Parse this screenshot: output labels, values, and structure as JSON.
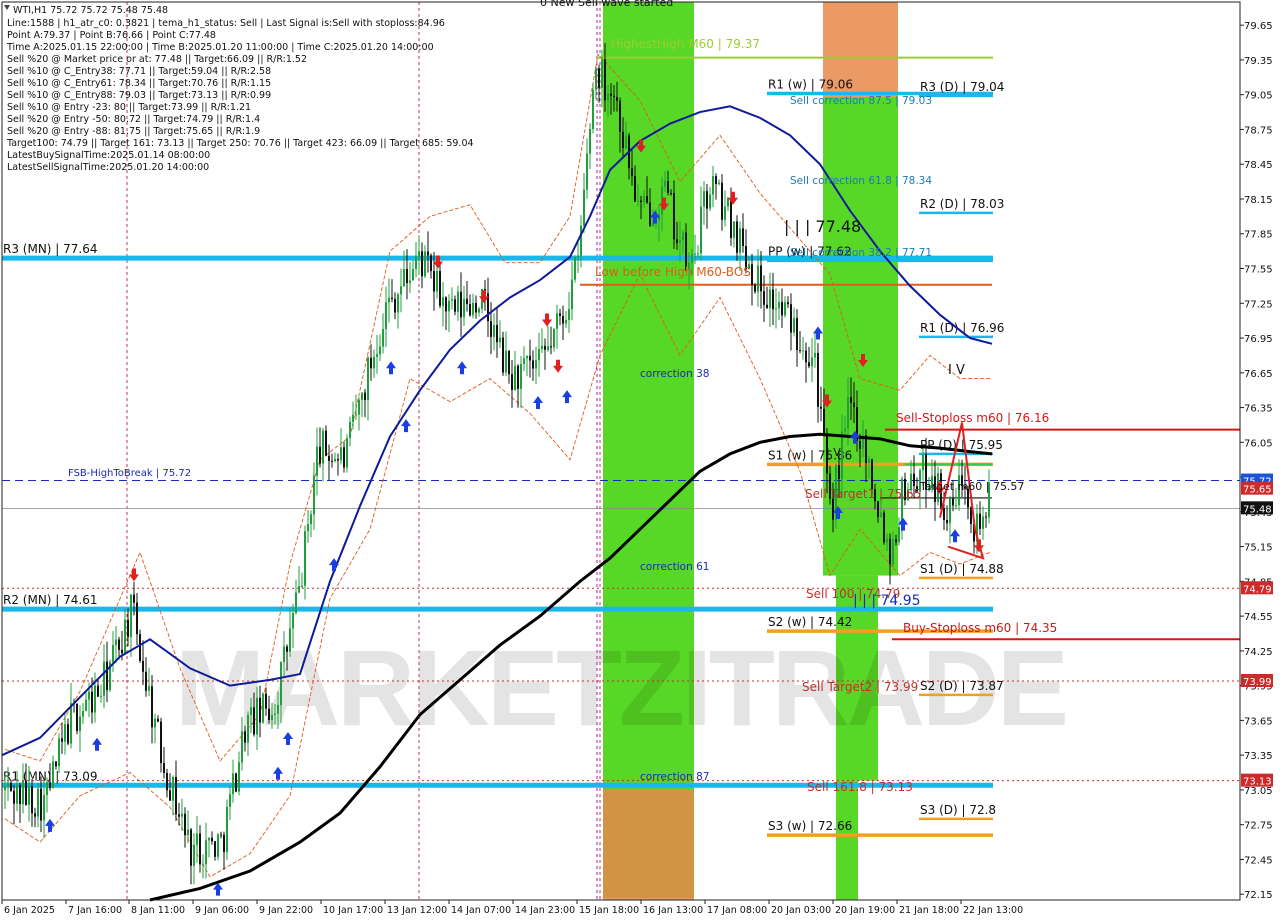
{
  "chart_data": {
    "type": "candlestick",
    "symbol": "WTI,H1",
    "header_line": "WTI,H1  75.72 75.72 75.48 75.48",
    "info_lines": [
      "Line:1588 | h1_atr_c0: 0.3821 | tema_h1_status: Sell | Last Signal is:Sell with stoploss:84.96",
      "Point A:79.37 | Point B:76.66 | Point C:77.48",
      "Time A:2025.01.15 22:00:00 | Time B:2025.01.20 11:00:00 | Time C:2025.01.20 14:00:00",
      "Sell %20 @ Market price or at: 77.48 || Target:66.09 || R/R:1.52",
      "Sell %10 @ C_Entry38: 77.71 || Target:59.04 || R/R:2.58",
      "Sell %10 @ C_Entry61: 78.34 || Target:70.76 || R/R:1.15",
      "Sell %10 @ C_Entry88: 79.03 || Target:73.13 || R/R:0.99",
      "Sell %10 @ Entry -23: 80 || Target:73.99 || R/R:1.21",
      "Sell %20 @ Entry -50: 80.72 || Target:74.79 || R/R:1.4",
      "Sell %20 @ Entry -88: 81.75 || Target:75.65 || R/R:1.9",
      "Target100: 74.79 || Target 161: 73.13 || Target 250: 70.76 || Target 423: 66.09 || Target 685: 59.04",
      "LatestBuySignalTime:2025.01.14 08:00:00",
      "LatestSellSignalTime:2025.01.20 14:00:00"
    ],
    "top_note": "0 New Sell wave started",
    "y_ticks": [
      "79.65",
      "79.35",
      "79.05",
      "78.75",
      "78.45",
      "78.15",
      "77.85",
      "77.55",
      "77.25",
      "76.95",
      "76.65",
      "76.35",
      "76.05",
      "75.75",
      "75.45",
      "75.15",
      "74.85",
      "74.55",
      "74.25",
      "73.95",
      "73.65",
      "73.35",
      "73.05",
      "72.75",
      "72.45",
      "72.15"
    ],
    "ylim": [
      72.1,
      79.85
    ],
    "x_ticks": [
      "6 Jan 2025",
      "7 Jan 16:00",
      "8 Jan 11:00",
      "9 Jan 06:00",
      "9 Jan 22:00",
      "10 Jan 17:00",
      "13 Jan 12:00",
      "14 Jan 07:00",
      "14 Jan 23:00",
      "15 Jan 18:00",
      "16 Jan 13:00",
      "17 Jan 08:00",
      "20 Jan 03:00",
      "20 Jan 19:00",
      "21 Jan 18:00",
      "22 Jan 13:00"
    ],
    "price_tags": [
      {
        "value": 75.72,
        "text": "75.72",
        "bg": "#1a52d8"
      },
      {
        "value": 75.65,
        "text": "75.65",
        "bg": "#cf2a2a"
      },
      {
        "value": 75.48,
        "text": "75.48",
        "bg": "#111111"
      },
      {
        "value": 74.79,
        "text": "74.79",
        "bg": "#cf2a2a"
      },
      {
        "value": 73.99,
        "text": "73.99",
        "bg": "#cf2a2a"
      },
      {
        "value": 73.13,
        "text": "73.13",
        "bg": "#cf2a2a"
      }
    ],
    "levels": [
      {
        "label": "R3 (MN) | 77.64",
        "value": 77.64,
        "color": "#1ab7ea",
        "style": "thick"
      },
      {
        "label": "R2 (MN) | 74.61",
        "value": 74.61,
        "color": "#1ab7ea",
        "style": "thick"
      },
      {
        "label": "R1 (MN) | 73.09",
        "value": 73.09,
        "color": "#1ab7ea",
        "style": "thick"
      },
      {
        "label": "R1 (w) | 79.06",
        "value": 79.06,
        "color": "#1ab7ea",
        "style": "medium"
      },
      {
        "label": "PP (w) | 77.62",
        "value": 77.62,
        "color": "#1ab7ea",
        "style": "medium"
      },
      {
        "label": "S1 (w) | 75.86",
        "value": 75.86,
        "color": "#f0a020",
        "style": "medium"
      },
      {
        "label": "S2 (w) | 74.42",
        "value": 74.42,
        "color": "#f0a020",
        "style": "medium"
      },
      {
        "label": "S3 (w) | 72.66",
        "value": 72.66,
        "color": "#f0a020",
        "style": "medium"
      },
      {
        "label": "R3 (D) | 79.04",
        "value": 79.04,
        "color": "#1ab7ea",
        "style": "short"
      },
      {
        "label": "R2 (D) | 78.03",
        "value": 78.03,
        "color": "#1ab7ea",
        "style": "short"
      },
      {
        "label": "R1 (D) | 76.96",
        "value": 76.96,
        "color": "#1ab7ea",
        "style": "short"
      },
      {
        "label": "PP (D) | 75.95",
        "value": 75.95,
        "color": "#1ab7ea",
        "style": "short"
      },
      {
        "label": "S1 (D) | 74.88",
        "value": 74.88,
        "color": "#f0a020",
        "style": "short"
      },
      {
        "label": "S2 (D) | 73.87",
        "value": 73.87,
        "color": "#f0a020",
        "style": "short"
      },
      {
        "label": "S3 (D) | 72.8",
        "value": 72.8,
        "color": "#f0a020",
        "style": "short"
      }
    ],
    "annotations": [
      {
        "text": "HighestHigh   M60 | 79.37",
        "value": 79.37,
        "color": "#9acd32"
      },
      {
        "text": "Low before High   M60-BOS",
        "value": 77.41,
        "color": "#e05a1a"
      },
      {
        "text": "Sell-Stoploss m60 | 76.16",
        "value": 76.16,
        "color": "#d01818"
      },
      {
        "text": "Buy-Stoploss m60 | 74.35",
        "value": 74.35,
        "color": "#d01818"
      },
      {
        "text": "FSB-HighToBreak | 75.72",
        "value": 75.72,
        "color": "#1a2bb8"
      },
      {
        "text": "Sell correction 87.5 | 79.03",
        "color": "#1a7ab8"
      },
      {
        "text": "Sell correction 61.8 | 78.34",
        "color": "#1a7ab8"
      },
      {
        "text": "Sell correction 38.2 | 77.71",
        "color": "#1a7ab8"
      },
      {
        "text": "correction 38",
        "color": "#1a2bb8"
      },
      {
        "text": "correction 61",
        "color": "#1a2bb8"
      },
      {
        "text": "correction 87",
        "color": "#1a2bb8"
      },
      {
        "text": "Sell Target1 | 75.65",
        "color": "#c03030"
      },
      {
        "text": "Sell 100 | 74.79",
        "color": "#c03030"
      },
      {
        "text": "Sell Target2 | 73.99",
        "color": "#c03030"
      },
      {
        "text": "Sell 161.8 | 73.13",
        "color": "#c03030"
      },
      {
        "text": "| | | 77.48",
        "color": "#111111"
      },
      {
        "text": "| | | 74.95",
        "color": "#1a2bb8"
      },
      {
        "text": "I V",
        "color": "#111111"
      },
      {
        "text": "| V",
        "color": "#111111"
      },
      {
        "text": "Target m60 | 75.57",
        "color": "#111111"
      }
    ],
    "watermark": "MARKETZITRADE",
    "colors": {
      "bull": "#1fa03a",
      "bear": "#111111",
      "ema_blue": "#0d1a9a",
      "ma_black": "#000000",
      "green_zone": "#4fd61a",
      "orange_zone": "#e8874a"
    }
  }
}
